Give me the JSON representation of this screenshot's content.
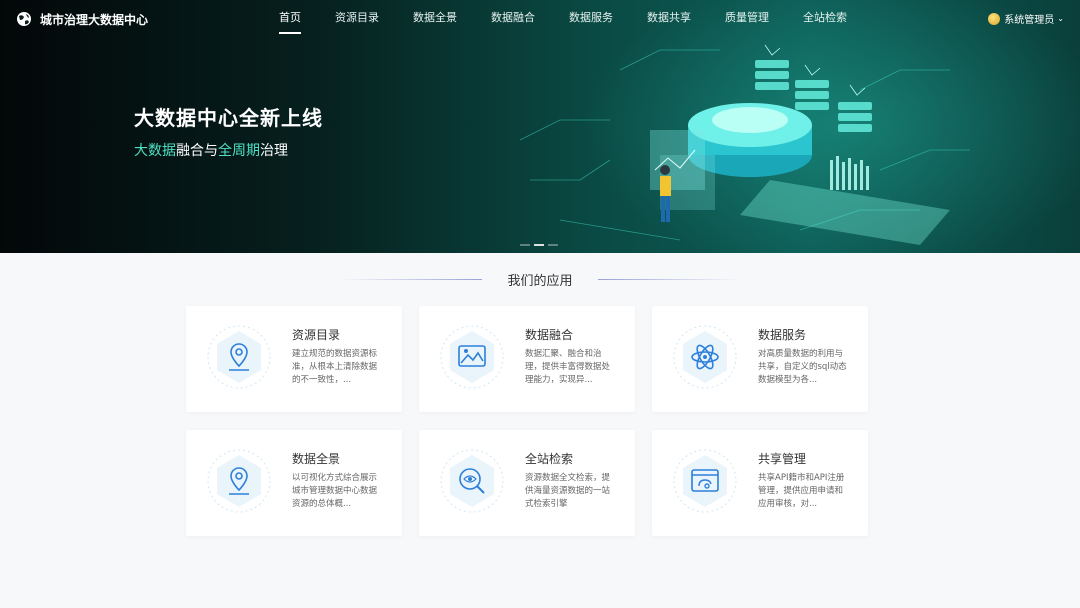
{
  "header": {
    "brand": "城市治理大数据中心",
    "nav": [
      "首页",
      "资源目录",
      "数据全景",
      "数据融合",
      "数据服务",
      "数据共享",
      "质量管理",
      "全站检索"
    ],
    "active_nav": 0,
    "user": "系统管理员"
  },
  "hero": {
    "title": "大数据中心全新上线",
    "subtitle_parts": [
      {
        "text": "大数据",
        "highlight": true
      },
      {
        "text": "融合与",
        "highlight": false
      },
      {
        "text": "全周期",
        "highlight": true
      },
      {
        "text": "治理",
        "highlight": false
      }
    ],
    "slides": 3,
    "active_slide": 1
  },
  "apps": {
    "section_title": "我们的应用",
    "items": [
      {
        "title": "资源目录",
        "desc": "建立规范的数据资源标准，从根本上清除数据的不一致性，...",
        "icon": "location-pin-icon"
      },
      {
        "title": "数据融合",
        "desc": "数据汇聚、融合和治理，提供丰富得数据处理能力，实现异...",
        "icon": "image-chart-icon"
      },
      {
        "title": "数据服务",
        "desc": "对高质量数据的利用与共享，自定义的sql动态数据模型为各...",
        "icon": "atom-icon"
      },
      {
        "title": "数据全景",
        "desc": "以可视化方式综合展示城市管理数据中心数据资源的总体概...",
        "icon": "location-pin-icon"
      },
      {
        "title": "全站检索",
        "desc": "资源数据全文检索，提供海量资源数据的一站式检索引擎",
        "icon": "search-eye-icon"
      },
      {
        "title": "共享管理",
        "desc": "共享API籍市和API注册管理，提供应用申请和应用审核，对...",
        "icon": "share-window-icon"
      }
    ]
  },
  "colors": {
    "accent": "#2e7fd9",
    "highlight": "#4fe0c4",
    "icon_bg": "#e9f4fb"
  }
}
